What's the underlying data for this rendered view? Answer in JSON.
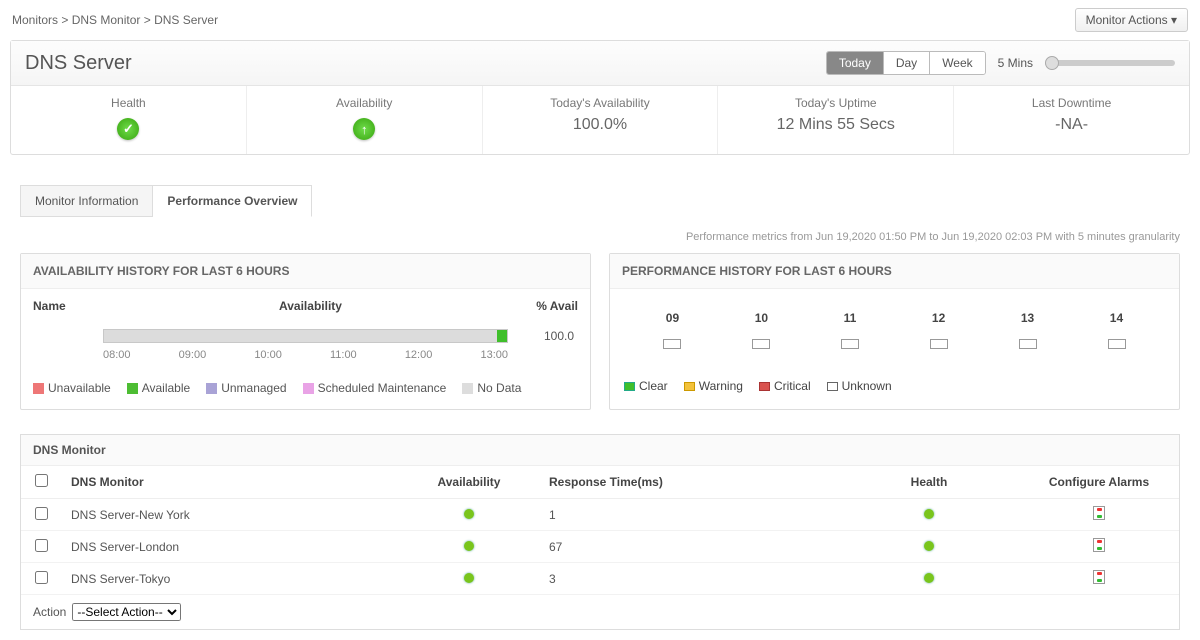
{
  "breadcrumb": {
    "a": "Monitors",
    "b": "DNS Monitor",
    "c": "DNS Server"
  },
  "actions_button": "Monitor Actions",
  "title": "DNS Server",
  "time_toggle": {
    "today": "Today",
    "day": "Day",
    "week": "Week"
  },
  "granularity_label": "5 Mins",
  "summary": {
    "health_label": "Health",
    "avail_label": "Availability",
    "today_avail_label": "Today's Availability",
    "today_avail_value": "100.0%",
    "uptime_label": "Today's Uptime",
    "uptime_value": "12 Mins 55 Secs",
    "downtime_label": "Last Downtime",
    "downtime_value": "-NA-"
  },
  "tabs": {
    "info": "Monitor Information",
    "perf": "Performance Overview"
  },
  "metrics_note": "Performance metrics from Jun 19,2020 01:50 PM to Jun 19,2020 02:03 PM with 5 minutes granularity",
  "avail_panel": {
    "title": "AVAILABILITY HISTORY FOR LAST 6 HOURS",
    "col_name": "Name",
    "col_avail": "Availability",
    "col_pct": "% Avail",
    "pct_value": "100.0",
    "axis": [
      "08:00",
      "09:00",
      "10:00",
      "11:00",
      "12:00",
      "13:00"
    ],
    "legend": {
      "unavailable": "Unavailable",
      "available": "Available",
      "unmanaged": "Unmanaged",
      "scheduled": "Scheduled Maintenance",
      "nodata": "No Data"
    }
  },
  "perf_panel": {
    "title": "PERFORMANCE HISTORY FOR LAST 6 HOURS",
    "hours": [
      "09",
      "10",
      "11",
      "12",
      "13",
      "14"
    ],
    "legend": {
      "clear": "Clear",
      "warning": "Warning",
      "critical": "Critical",
      "unknown": "Unknown"
    }
  },
  "dns_panel": {
    "title": "DNS Monitor",
    "headers": {
      "name": "DNS Monitor",
      "avail": "Availability",
      "resp": "Response Time(ms)",
      "health": "Health",
      "alarm": "Configure Alarms"
    },
    "rows": [
      {
        "name": "DNS Server-New York",
        "resp": "1"
      },
      {
        "name": "DNS Server-London",
        "resp": "67"
      },
      {
        "name": "DNS Server-Tokyo",
        "resp": "3"
      }
    ],
    "action_label": "Action",
    "action_placeholder": "--Select Action--"
  },
  "chart_data": {
    "availability_history": {
      "type": "bar",
      "x_range_hours": [
        "08:00",
        "14:00"
      ],
      "percent_available": 100.0,
      "segments": [
        {
          "status": "no_data_or_available_grey",
          "fraction": 0.98
        },
        {
          "status": "available",
          "fraction": 0.02
        }
      ]
    },
    "performance_history": {
      "type": "heatmap",
      "hours": [
        "09",
        "10",
        "11",
        "12",
        "13",
        "14"
      ],
      "status_per_hour": [
        "unknown",
        "unknown",
        "unknown",
        "unknown",
        "unknown",
        "unknown"
      ]
    }
  }
}
